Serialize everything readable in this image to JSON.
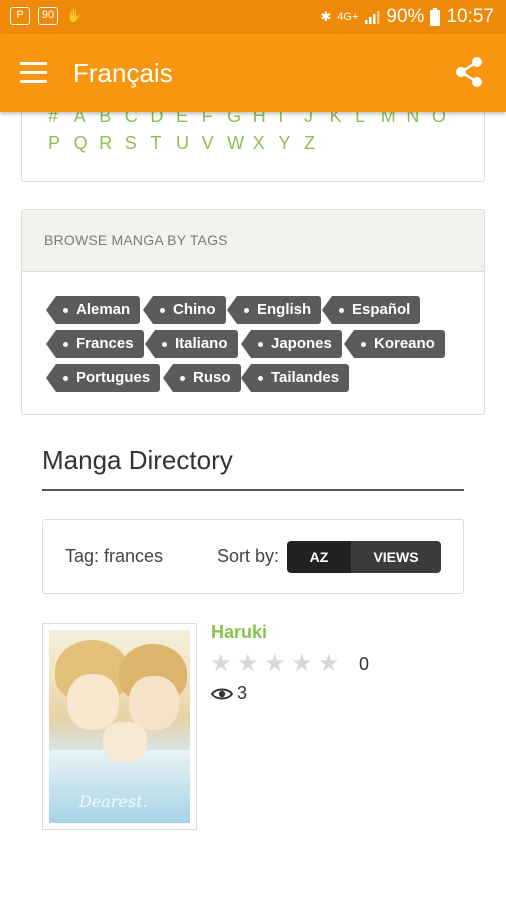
{
  "status_bar": {
    "time": "10:57",
    "battery": "90%",
    "network": "4G+",
    "icons": [
      "app-p-icon",
      "picture-icon",
      "hand-icon",
      "bluetooth-icon",
      "signal-icon",
      "battery-icon"
    ]
  },
  "app_bar": {
    "title": "Français",
    "color": "#f9960f",
    "icons": [
      "menu-icon",
      "share-icon"
    ]
  },
  "alphabet": {
    "row1": [
      "#",
      "A",
      "B",
      "C",
      "D",
      "E",
      "F",
      "G",
      "H",
      "I",
      "J",
      "K",
      "L",
      "M",
      "N",
      "O"
    ],
    "row2": [
      "P",
      "Q",
      "R",
      "S",
      "T",
      "U",
      "V",
      "W",
      "X",
      "Y",
      "Z"
    ],
    "color": "#8cc152"
  },
  "tags_section": {
    "header": "BROWSE MANGA BY TAGS",
    "tags": [
      "Aleman",
      "Chino",
      "English",
      "Español",
      "Frances",
      "Italiano",
      "Japones",
      "Koreano",
      "Portugues",
      "Ruso",
      "Tailandes"
    ]
  },
  "directory": {
    "title": "Manga Directory",
    "tag_label": "Tag: frances",
    "sort_label": "Sort by:",
    "sort_options": [
      "AZ",
      "VIEWS"
    ],
    "sort_selected": "AZ"
  },
  "manga_items": [
    {
      "title": "Haruki",
      "rating_stars": 0,
      "rating_max": 5,
      "rating_count": "0",
      "views": "3",
      "cover_caption": "Dearest."
    }
  ]
}
